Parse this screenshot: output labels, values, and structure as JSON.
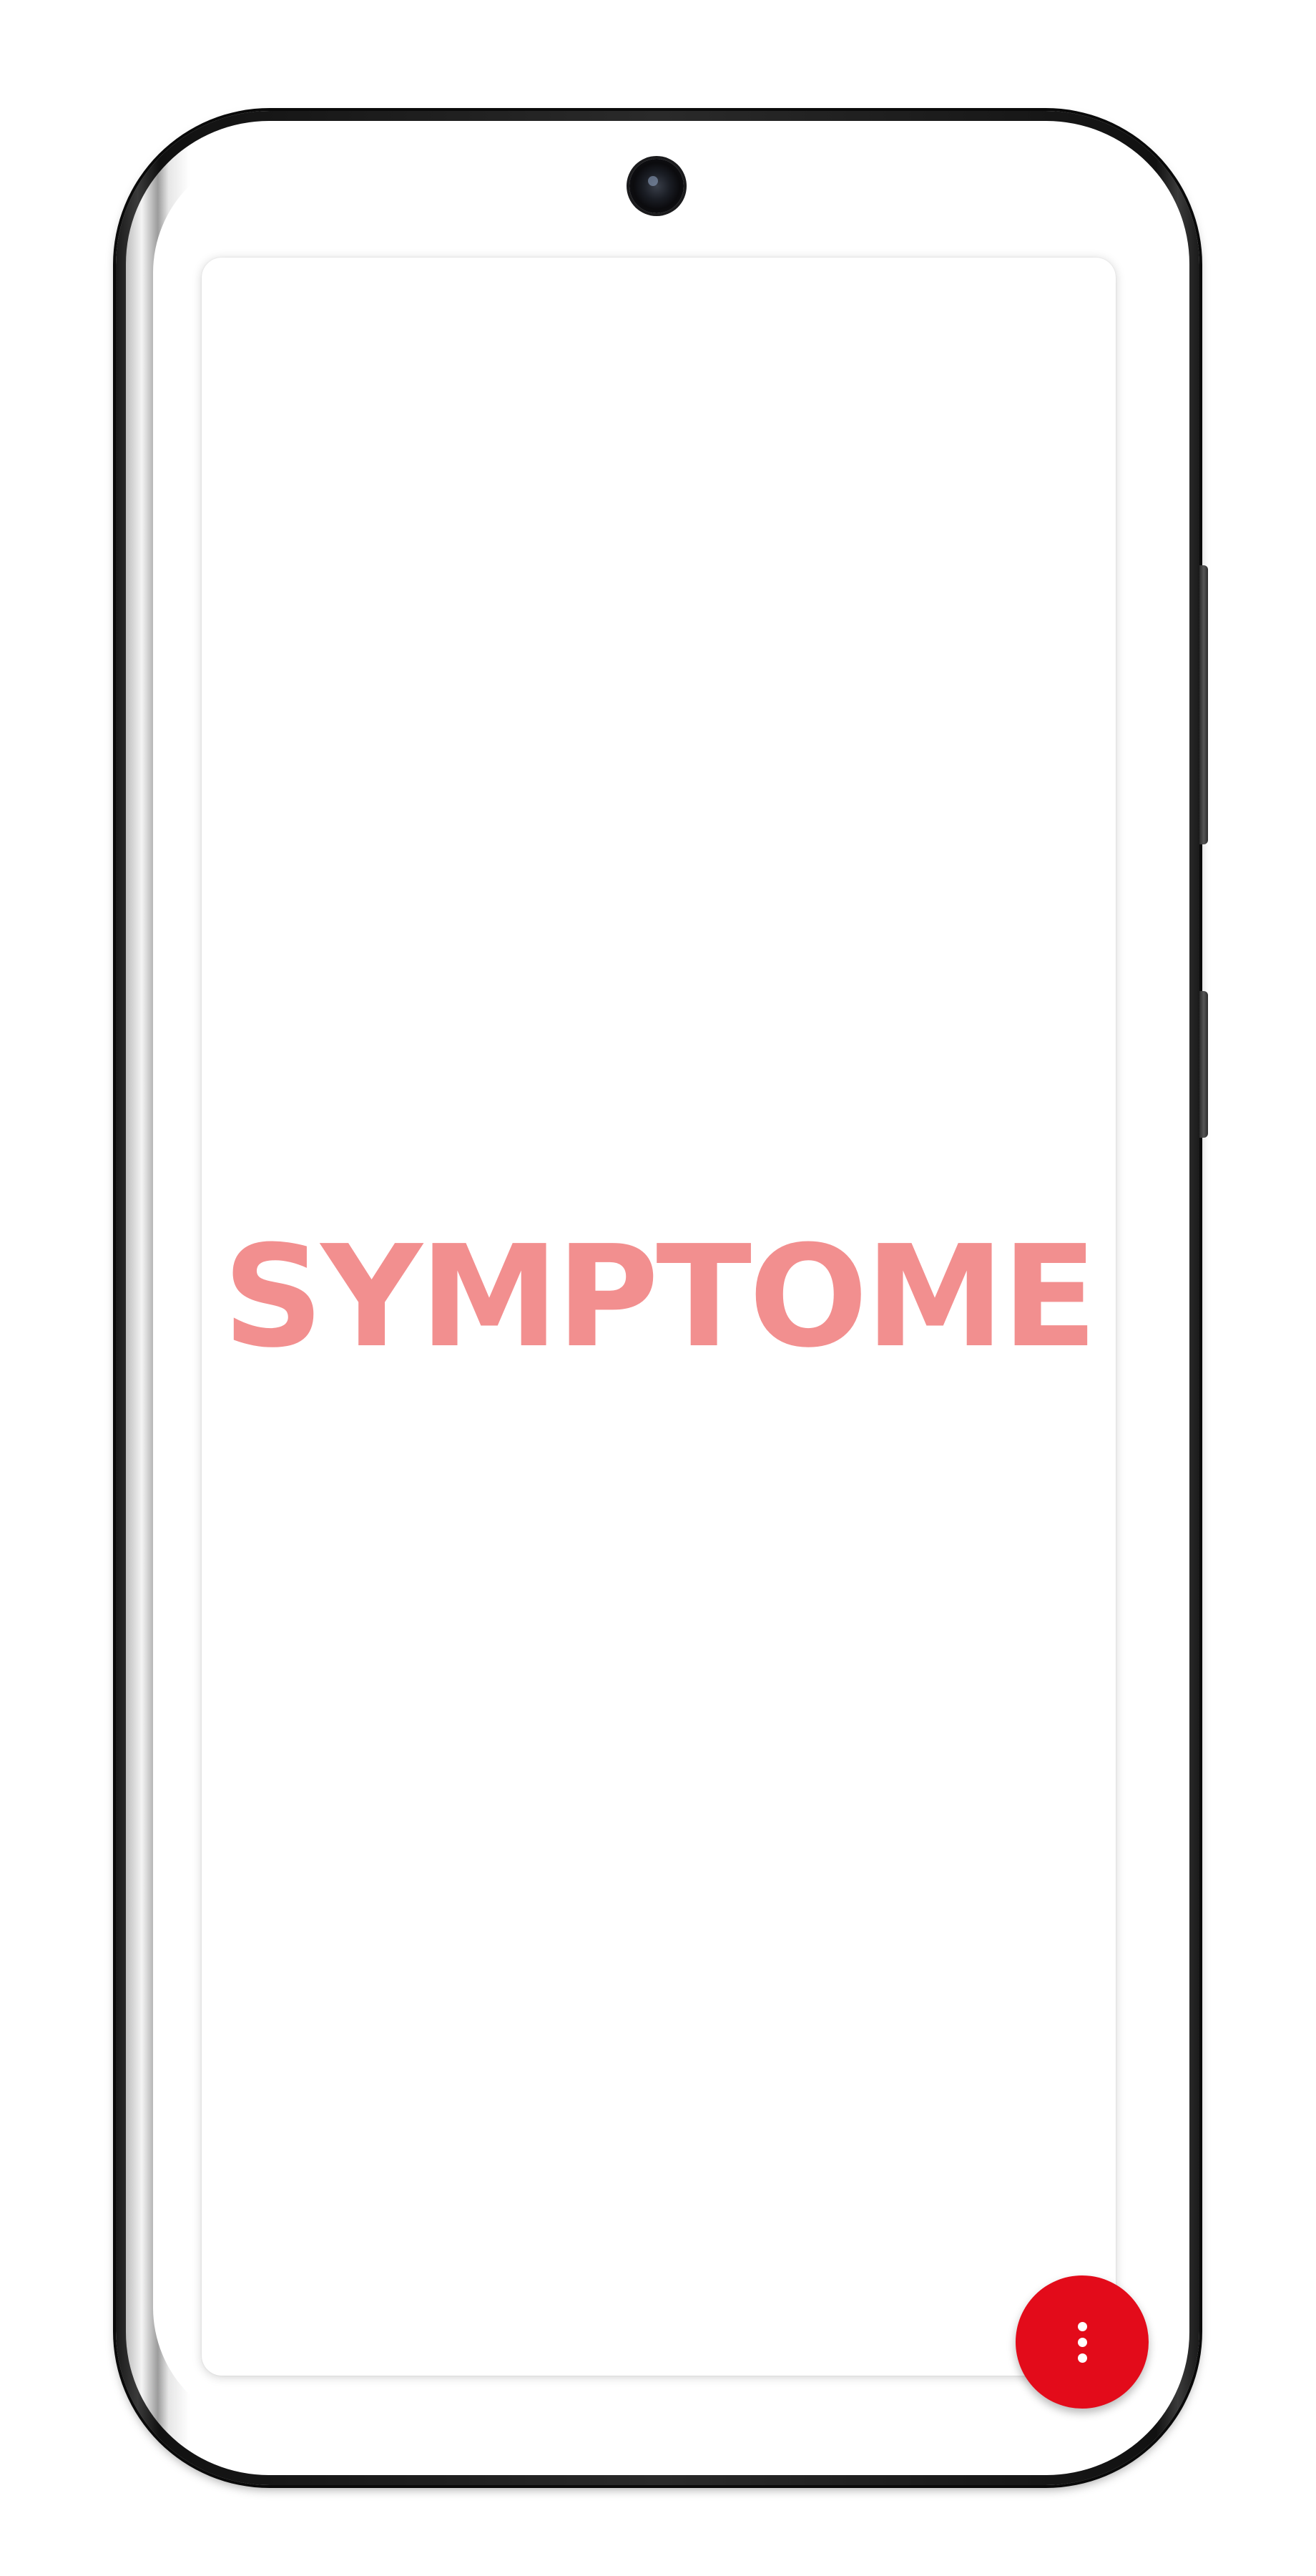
{
  "app": {
    "brand_name": "SYMPTOME"
  },
  "fab": {
    "icon": "more-vertical-icon"
  },
  "colors": {
    "brand_text": "#f28f8f",
    "fab_background": "#e30b1a",
    "screen_background": "#ffffff",
    "device_frame": "#1a1a1a"
  }
}
